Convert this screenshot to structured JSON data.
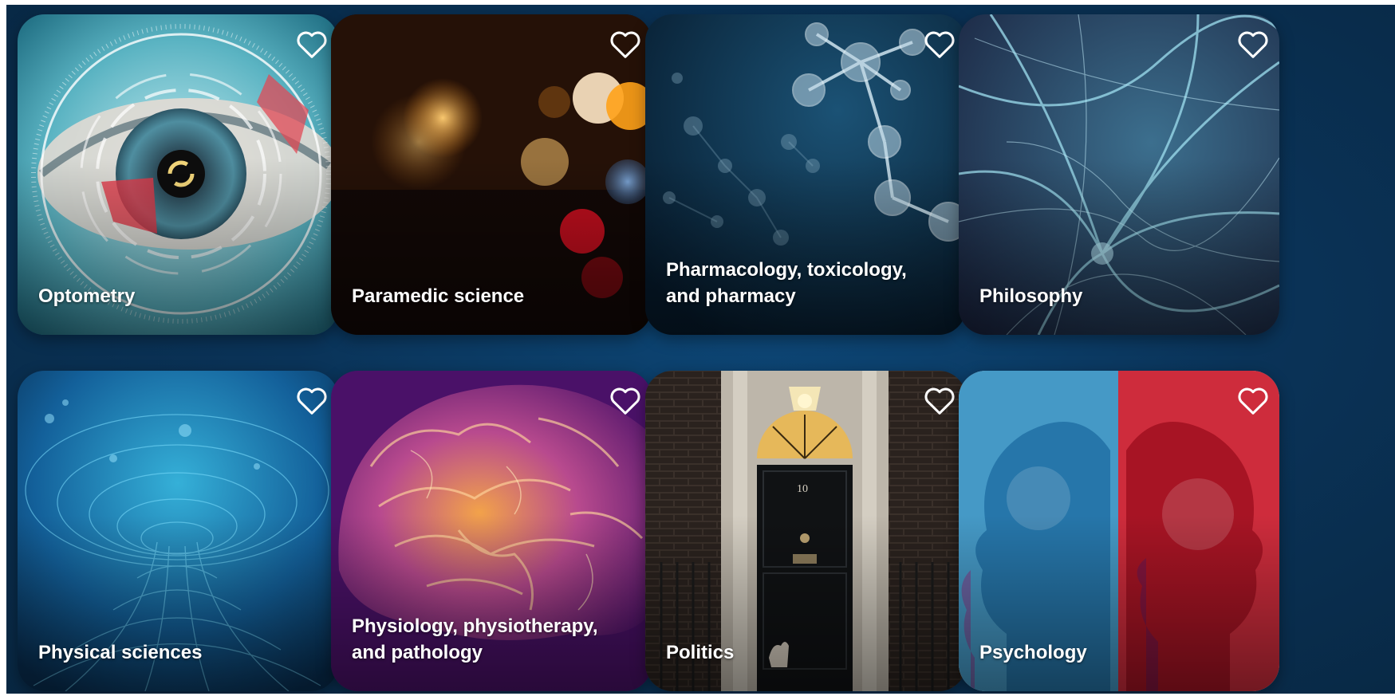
{
  "cards": [
    {
      "title": "Optometry",
      "favorite_icon": "heart-outline-icon"
    },
    {
      "title": "Paramedic science",
      "favorite_icon": "heart-outline-icon"
    },
    {
      "title": "Pharmacology, toxicology, and pharmacy",
      "favorite_icon": "heart-outline-icon"
    },
    {
      "title": "Philosophy",
      "favorite_icon": "heart-outline-icon"
    },
    {
      "title": "Physical sciences",
      "favorite_icon": "heart-outline-icon"
    },
    {
      "title": "Physiology, physiotherapy, and pathology",
      "favorite_icon": "heart-outline-icon"
    },
    {
      "title": "Politics",
      "favorite_icon": "heart-outline-icon"
    },
    {
      "title": "Psychology",
      "favorite_icon": "heart-outline-icon"
    }
  ],
  "colors": {
    "page_background": "#0a3358",
    "title_text": "#ffffff",
    "heart_stroke": "#ffffff"
  }
}
